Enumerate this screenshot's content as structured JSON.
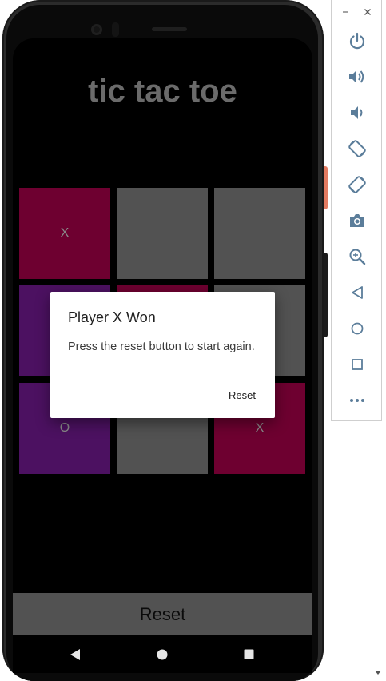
{
  "app": {
    "title": "tic tac toe",
    "board": [
      {
        "mark": "X",
        "color": "#6e0030"
      },
      {
        "mark": "",
        "color": "#525252"
      },
      {
        "mark": "",
        "color": "#525252"
      },
      {
        "mark": "",
        "color": "#4c1161"
      },
      {
        "mark": "",
        "color": "#6e0030"
      },
      {
        "mark": "",
        "color": "#525252"
      },
      {
        "mark": "O",
        "color": "#4c1161"
      },
      {
        "mark": "",
        "color": "#525252"
      },
      {
        "mark": "X",
        "color": "#6e0030"
      }
    ],
    "reset_label": "Reset"
  },
  "dialog": {
    "title": "Player X Won",
    "message": "Press the reset button to start again.",
    "button_label": "Reset"
  },
  "navbar": {
    "icons": [
      "back-icon",
      "home-icon",
      "recents-icon"
    ]
  },
  "emulator_toolbar": {
    "window_controls": [
      "minimize-icon",
      "close-icon"
    ],
    "buttons": [
      "power-icon",
      "volume-up-icon",
      "volume-down-icon",
      "rotate-left-icon",
      "rotate-right-icon",
      "camera-icon",
      "zoom-icon",
      "back-icon",
      "home-icon",
      "overview-icon",
      "more-icon"
    ]
  },
  "colors": {
    "x_cell": "#6e0030",
    "o_cell": "#4c1161",
    "empty_cell": "#525252",
    "title": "#6b6b6b",
    "toolbar_icon": "#5b7d9a"
  }
}
